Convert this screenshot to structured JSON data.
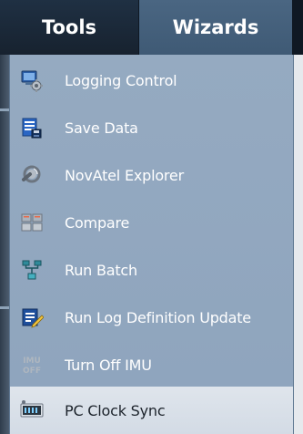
{
  "tabs": {
    "tools": "Tools",
    "wizards": "Wizards"
  },
  "menu": {
    "items": [
      {
        "label": "Logging Control",
        "icon": "logging-control-icon"
      },
      {
        "label": "Save Data",
        "icon": "save-data-icon"
      },
      {
        "label": "NovAtel Explorer",
        "icon": "novatel-explorer-icon"
      },
      {
        "label": "Compare",
        "icon": "compare-icon"
      },
      {
        "label": "Run Batch",
        "icon": "run-batch-icon"
      },
      {
        "label": "Run Log Definition Update",
        "icon": "run-log-definition-update-icon"
      },
      {
        "label": "Turn Off IMU",
        "icon": "turn-off-imu-icon",
        "badge_top": "IMU",
        "badge_bottom": "OFF"
      },
      {
        "label": "PC Clock Sync",
        "icon": "pc-clock-sync-icon",
        "highlighted": true
      }
    ]
  },
  "colors": {
    "tabbar": "#1b2a3a",
    "wizards_tab": "#456079",
    "menu_bg": "#92a8bf",
    "highlight": "#d9e0e8"
  }
}
